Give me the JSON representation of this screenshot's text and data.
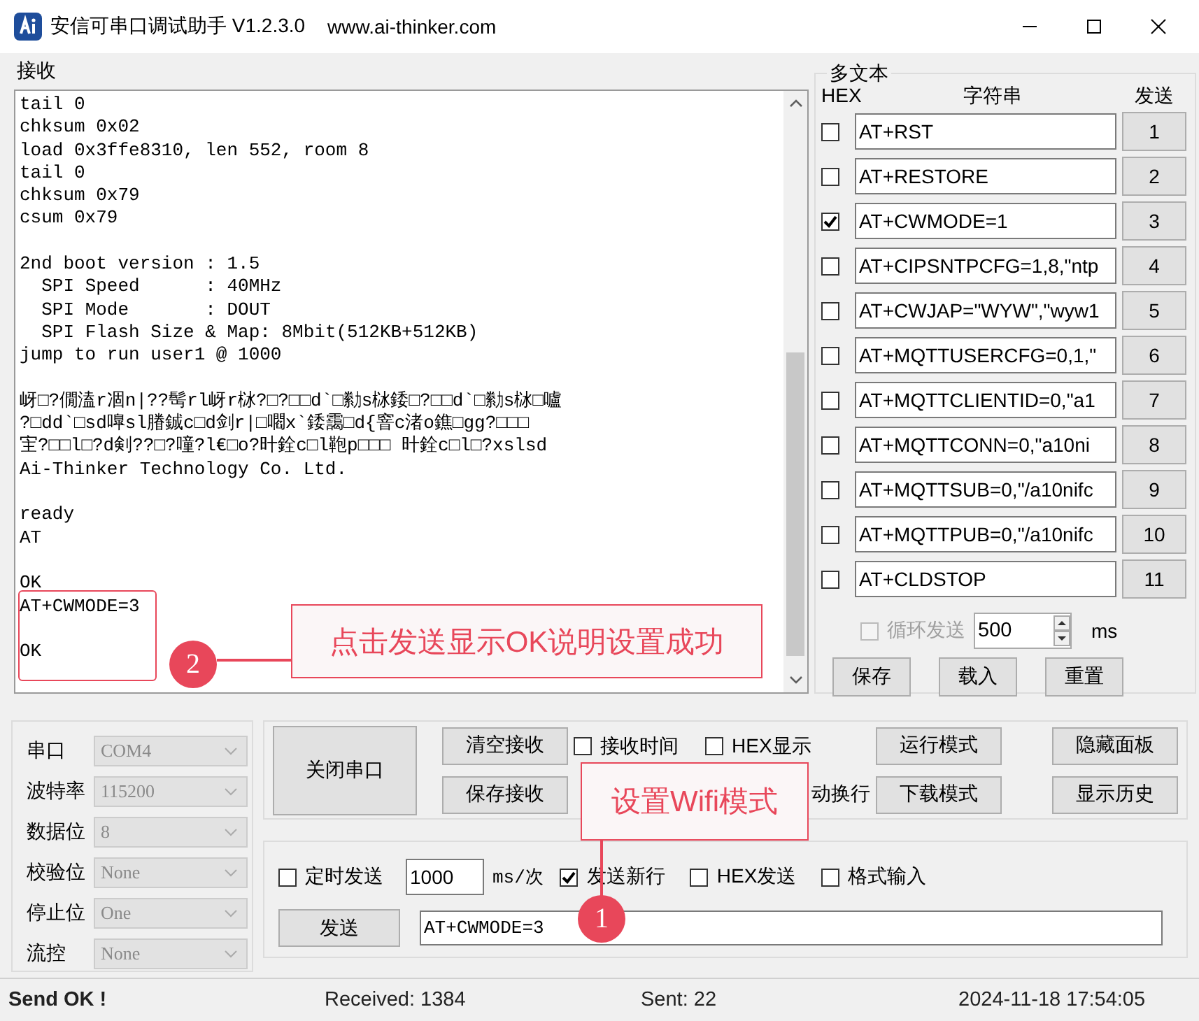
{
  "window": {
    "title": "安信可串口调试助手 V1.2.3.0",
    "url": "www.ai-thinker.com"
  },
  "receive": {
    "label": "接收",
    "blocks": [
      [
        "tail 0",
        "chksum 0x02",
        "load 0x3ffe8310, len 552, room 8",
        "tail 0",
        "chksum 0x79",
        "csum 0x79"
      ],
      [
        "2nd boot version : 1.5",
        "  SPI Speed      : 40MHz",
        "  SPI Mode       : DOUT",
        "  SPI Flash Size & Map: 8Mbit(512KB+512KB)",
        "jump to run user1 @ 1000"
      ],
      [
        "岈□?僩溘r凅n|??髩rl岈r栤?□?□□d`□勬s栤錗□?□□d`□勬s栤□嚧",
        "?□dd`□sd嘷sl膡鋮c□d剑r|□嚪x`錗靄□d{窨c渚o鐎□gg?□□□",
        "宔?□□l□?d剣??□?噇?l€□o?旪銓c□l鞄p□□□ 旪銓c□l□?xslsd",
        "Ai-Thinker Technology Co. Ltd."
      ],
      [
        "ready",
        "AT"
      ],
      [
        "OK",
        "AT+CWMODE=3"
      ],
      [
        "OK"
      ]
    ]
  },
  "multi_text": {
    "label": "多文本",
    "headers": {
      "hex": "HEX",
      "string": "字符串",
      "send": "发送"
    },
    "rows": [
      {
        "hex": false,
        "text": "AT+RST",
        "button": "1"
      },
      {
        "hex": false,
        "text": "AT+RESTORE",
        "button": "2"
      },
      {
        "hex": true,
        "text": "AT+CWMODE=1",
        "button": "3"
      },
      {
        "hex": false,
        "text": "AT+CIPSNTPCFG=1,8,\"ntp",
        "button": "4"
      },
      {
        "hex": false,
        "text": "AT+CWJAP=\"WYW\",\"wyw1",
        "button": "5"
      },
      {
        "hex": false,
        "text": "AT+MQTTUSERCFG=0,1,\"",
        "button": "6"
      },
      {
        "hex": false,
        "text": "AT+MQTTCLIENTID=0,\"a1",
        "button": "7"
      },
      {
        "hex": false,
        "text": "AT+MQTTCONN=0,\"a10ni",
        "button": "8"
      },
      {
        "hex": false,
        "text": "AT+MQTTSUB=0,\"/a10nifc",
        "button": "9"
      },
      {
        "hex": false,
        "text": "AT+MQTTPUB=0,\"/a10nifc",
        "button": "10"
      },
      {
        "hex": false,
        "text": "AT+CLDSTOP",
        "button": "11"
      }
    ],
    "loop": {
      "label": "循环发送",
      "checked": false,
      "disabled": true,
      "interval": "500",
      "unit": "ms"
    },
    "buttons": [
      "保存",
      "载入",
      "重置"
    ]
  },
  "serial_settings": [
    {
      "label": "串口",
      "value": "COM4",
      "disabled": true
    },
    {
      "label": "波特率",
      "value": "115200",
      "disabled": true
    },
    {
      "label": "数据位",
      "value": "8",
      "disabled": true
    },
    {
      "label": "校验位",
      "value": "None",
      "disabled": true
    },
    {
      "label": "停止位",
      "value": "One",
      "disabled": true
    },
    {
      "label": "流控",
      "value": "None",
      "disabled": true
    }
  ],
  "receive_controls": {
    "port_button": "关闭串口",
    "buttons": [
      "清空接收",
      "保存接收"
    ],
    "options": [
      {
        "label": "接收时间",
        "checked": false
      },
      {
        "label": "HEX显示",
        "checked": false
      },
      {
        "label": "动换行"
      }
    ],
    "mode_buttons": [
      "运行模式",
      "下载模式"
    ],
    "panel_buttons": [
      "隐藏面板",
      "显示历史"
    ]
  },
  "send": {
    "timed": {
      "label": "定时发送",
      "checked": false
    },
    "interval": "1000",
    "unit": "ms/次",
    "options": [
      {
        "label": "发送新行",
        "checked": true
      },
      {
        "label": "HEX发送",
        "checked": false
      },
      {
        "label": "格式输入",
        "checked": false
      }
    ],
    "button": "发送",
    "value": "AT+CWMODE=3"
  },
  "status_bar": {
    "message": "Send OK !",
    "received": "Received: 1384",
    "sent": "Sent: 22",
    "time": "2024-11-18 17:54:05"
  },
  "annotations": [
    {
      "number": "2",
      "text": "点击发送显示OK说明设置成功",
      "highlight": true
    },
    {
      "number": "1",
      "text": "设置Wifi模式",
      "highlight": false
    }
  ]
}
